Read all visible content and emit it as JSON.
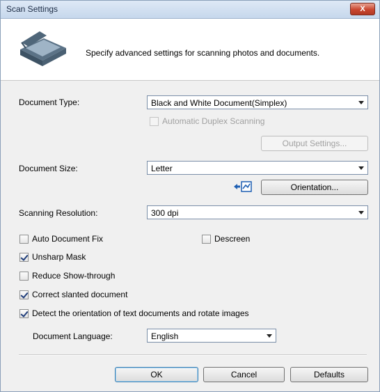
{
  "window": {
    "title": "Scan Settings",
    "close_label": "X"
  },
  "header": {
    "description": "Specify advanced settings for scanning photos and documents."
  },
  "document_type": {
    "label": "Document Type:",
    "value": "Black and White Document(Simplex)"
  },
  "auto_duplex": {
    "label": "Automatic Duplex Scanning",
    "checked": false,
    "enabled": false
  },
  "output_settings": {
    "label": "Output Settings..."
  },
  "document_size": {
    "label": "Document Size:",
    "value": "Letter"
  },
  "orientation": {
    "label": "Orientation..."
  },
  "scanning_resolution": {
    "label": "Scanning Resolution:",
    "value": "300 dpi"
  },
  "options": {
    "auto_document_fix": {
      "label": "Auto Document Fix",
      "checked": false
    },
    "descreen": {
      "label": "Descreen",
      "checked": false
    },
    "unsharp_mask": {
      "label": "Unsharp Mask",
      "checked": true
    },
    "reduce_show_through": {
      "label": "Reduce Show-through",
      "checked": false
    },
    "correct_slanted": {
      "label": "Correct slanted document",
      "checked": true
    },
    "detect_orientation": {
      "label": "Detect the orientation of text documents and rotate images",
      "checked": true
    }
  },
  "document_language": {
    "label": "Document Language:",
    "value": "English"
  },
  "buttons": {
    "ok": "OK",
    "cancel": "Cancel",
    "defaults": "Defaults"
  },
  "colors": {
    "accent": "#3c7fb1",
    "title_bg": "#c6d7ec",
    "close": "#c9462f"
  }
}
